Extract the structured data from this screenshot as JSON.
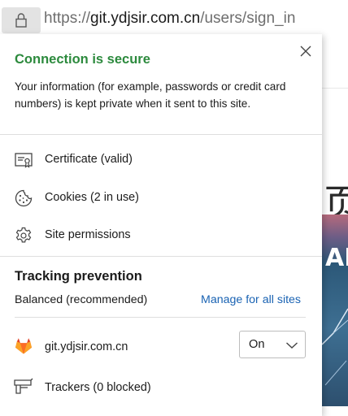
{
  "address_bar": {
    "url_scheme": "https://",
    "url_host": "git.ydjsir.com.cn",
    "url_path": "/users/sign_in"
  },
  "background_page": {
    "heading_char": "页",
    "hero_text": "AE"
  },
  "flyout": {
    "connection": {
      "title": "Connection is secure",
      "description": "Your information (for example, passwords or credit card numbers) is kept private when it sent to this site.",
      "title_color": "#2c8a3d"
    },
    "items": [
      {
        "label": "Certificate (valid)",
        "icon": "certificate-icon"
      },
      {
        "label": "Cookies (2 in use)",
        "icon": "cookie-icon"
      },
      {
        "label": "Site permissions",
        "icon": "gear-icon"
      }
    ],
    "tracking": {
      "title": "Tracking prevention",
      "level": "Balanced (recommended)",
      "manage_link": "Manage for all sites",
      "link_color": "#1a63b3",
      "site": {
        "name": "git.ydjsir.com.cn",
        "icon": "gitlab-icon",
        "toggle_value": "On"
      },
      "trackers_label": "Trackers (0 blocked)"
    }
  }
}
